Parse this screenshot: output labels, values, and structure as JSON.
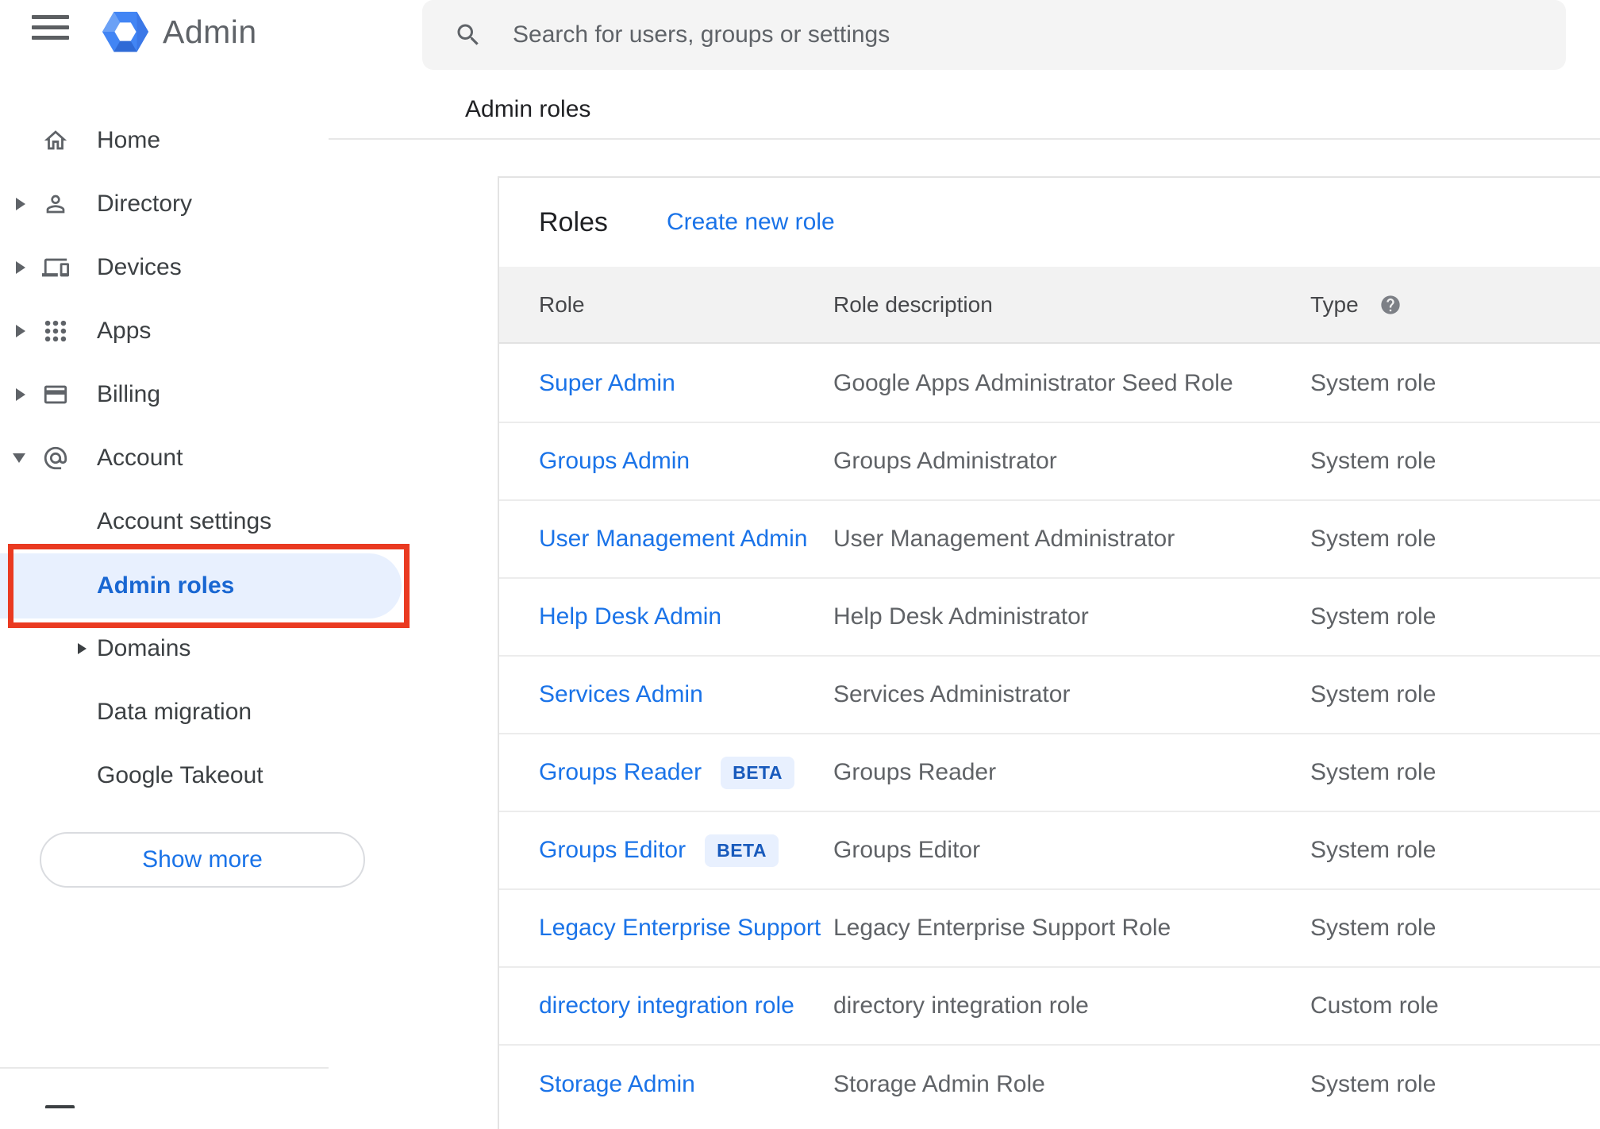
{
  "topbar": {
    "product_name": "Admin",
    "search_placeholder": "Search for users, groups or settings"
  },
  "page": {
    "breadcrumb": "Admin roles"
  },
  "sidebar": {
    "items": [
      {
        "label": "Home",
        "icon": "home",
        "expandable": false
      },
      {
        "label": "Directory",
        "icon": "person",
        "expandable": true
      },
      {
        "label": "Devices",
        "icon": "devices",
        "expandable": true
      },
      {
        "label": "Apps",
        "icon": "apps-grid",
        "expandable": true
      },
      {
        "label": "Billing",
        "icon": "credit-card",
        "expandable": true
      },
      {
        "label": "Account",
        "icon": "at-sign",
        "expandable": true,
        "expanded": true
      }
    ],
    "account_children": [
      {
        "label": "Account settings",
        "active": false
      },
      {
        "label": "Admin roles",
        "active": true
      },
      {
        "label": "Domains",
        "expandable": true,
        "active": false
      },
      {
        "label": "Data migration",
        "active": false
      },
      {
        "label": "Google Takeout",
        "active": false
      }
    ],
    "show_more": "Show more"
  },
  "roles_panel": {
    "title": "Roles",
    "create_link": "Create new role",
    "beta_badge": "BETA",
    "columns": {
      "role": "Role",
      "description": "Role description",
      "type": "Type"
    },
    "rows": [
      {
        "role": "Super Admin",
        "description": "Google Apps Administrator Seed Role",
        "type": "System role",
        "beta": false
      },
      {
        "role": "Groups Admin",
        "description": "Groups Administrator",
        "type": "System role",
        "beta": false
      },
      {
        "role": "User Management Admin",
        "description": "User Management Administrator",
        "type": "System role",
        "beta": false
      },
      {
        "role": "Help Desk Admin",
        "description": "Help Desk Administrator",
        "type": "System role",
        "beta": false
      },
      {
        "role": "Services Admin",
        "description": "Services Administrator",
        "type": "System role",
        "beta": false
      },
      {
        "role": "Groups Reader",
        "description": "Groups Reader",
        "type": "System role",
        "beta": true
      },
      {
        "role": "Groups Editor",
        "description": "Groups Editor",
        "type": "System role",
        "beta": true
      },
      {
        "role": "Legacy Enterprise Support",
        "description": "Legacy Enterprise Support Role",
        "type": "System role",
        "beta": false
      },
      {
        "role": "directory integration role",
        "description": "directory integration role",
        "type": "Custom role",
        "beta": false
      },
      {
        "role": "Storage Admin",
        "description": "Storage Admin Role",
        "type": "System role",
        "beta": false
      }
    ]
  },
  "colors": {
    "link_blue": "#1a73e8",
    "active_item_text": "#1967d2",
    "active_item_bg": "#e8f0fe",
    "annotation_red": "#ea3a21",
    "beta_badge_bg": "#e8f0fe",
    "beta_badge_text": "#185abc",
    "table_header_bg": "#f2f2f2",
    "search_bar_bg": "#f4f4f4",
    "icon_gray": "#5f6368"
  }
}
